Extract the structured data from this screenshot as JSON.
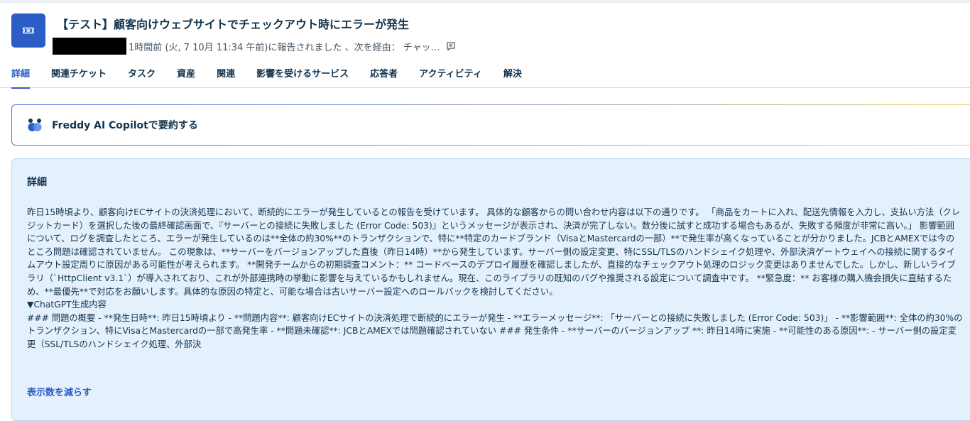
{
  "header": {
    "title": "【テスト】顧客向けウェブサイトでチェックアウト時にエラーが発生",
    "meta_text": "1時間前 (火, 7 10月 11:34 午前)に報告されました 、次を経由： チャッ…"
  },
  "tabs": [
    {
      "label": "詳細",
      "active": true
    },
    {
      "label": "関連チケット"
    },
    {
      "label": "タスク"
    },
    {
      "label": "資産"
    },
    {
      "label": "関連"
    },
    {
      "label": "影響を受けるサービス"
    },
    {
      "label": "応答者"
    },
    {
      "label": "アクティビティ"
    },
    {
      "label": "解決"
    }
  ],
  "freddy": {
    "label": "Freddy AI Copilotで要約する"
  },
  "details": {
    "title": "詳細",
    "paragraph": "昨日15時頃より、顧客向けECサイトの決済処理において、断続的にエラーが発生しているとの報告を受けています。 具体的な顧客からの問い合わせ内容は以下の通りです。 「商品をカートに入れ、配送先情報を入力し、支払い方法（クレジットカード）を選択した後の最終確認画面で、『サーバーとの接続に失敗しました (Error Code: 503)』というメッセージが表示され、決済が完了しない。数分後に試すと成功する場合もあるが、失敗する頻度が非常に高い。」 影響範囲について、ログを調査したところ、エラーが発生しているのは**全体の約30%**のトランザクションで、特に**特定のカードブランド（VisaとMastercardの一部）**で発生率が高くなっていることが分かりました。JCBとAMEXでは今のところ問題は確認されていません。 この現象は、**サーバーをバージョンアップした直後（昨日14時）**から発生しています。サーバー側の設定変更、特にSSL/TLSのハンドシェイク処理や、外部決済ゲートウェイへの接続に関するタイムアウト設定周りに原因がある可能性が考えられます。 **開発チームからの初期調査コメント：** コードベースのデプロイ履歴を確認しましたが、直接的なチェックアウト処理のロジック変更はありませんでした。しかし、新しいライブラリ（`HttpClient v3.1`）が導入されており、これが外部連携時の挙動に影響を与えているかもしれません。現在、このライブラリの既知のバグや推奨される設定について調査中です。 **緊急度：** お客様の購入機会損失に直結するため、**最優先**で対応をお願いします。具体的な原因の特定と、可能な場合は古いサーバー設定へのロールバックを検討してください。",
    "chatgpt_heading": "▼ChatGPT生成内容",
    "chatgpt_text": "### 問題の概要 - **発生日時**: 昨日15時頃より - **問題内容**: 顧客向けECサイトの決済処理で断続的にエラーが発生 - **エラーメッセージ**: 「サーバーとの接続に失敗しました (Error Code: 503)」 - **影響範囲**: 全体の約30%のトランザクション、特にVisaとMastercardの一部で高発生率 - **問題未確認**: JCBとAMEXでは問題確認されていない ### 発生条件 - **サーバーのバージョンアップ **: 昨日14時に実施 - **可能性のある原因**: - サーバー側の設定変更（SSL/TLSのハンドシェイク処理、外部決",
    "show_less": "表示数を減らす"
  }
}
